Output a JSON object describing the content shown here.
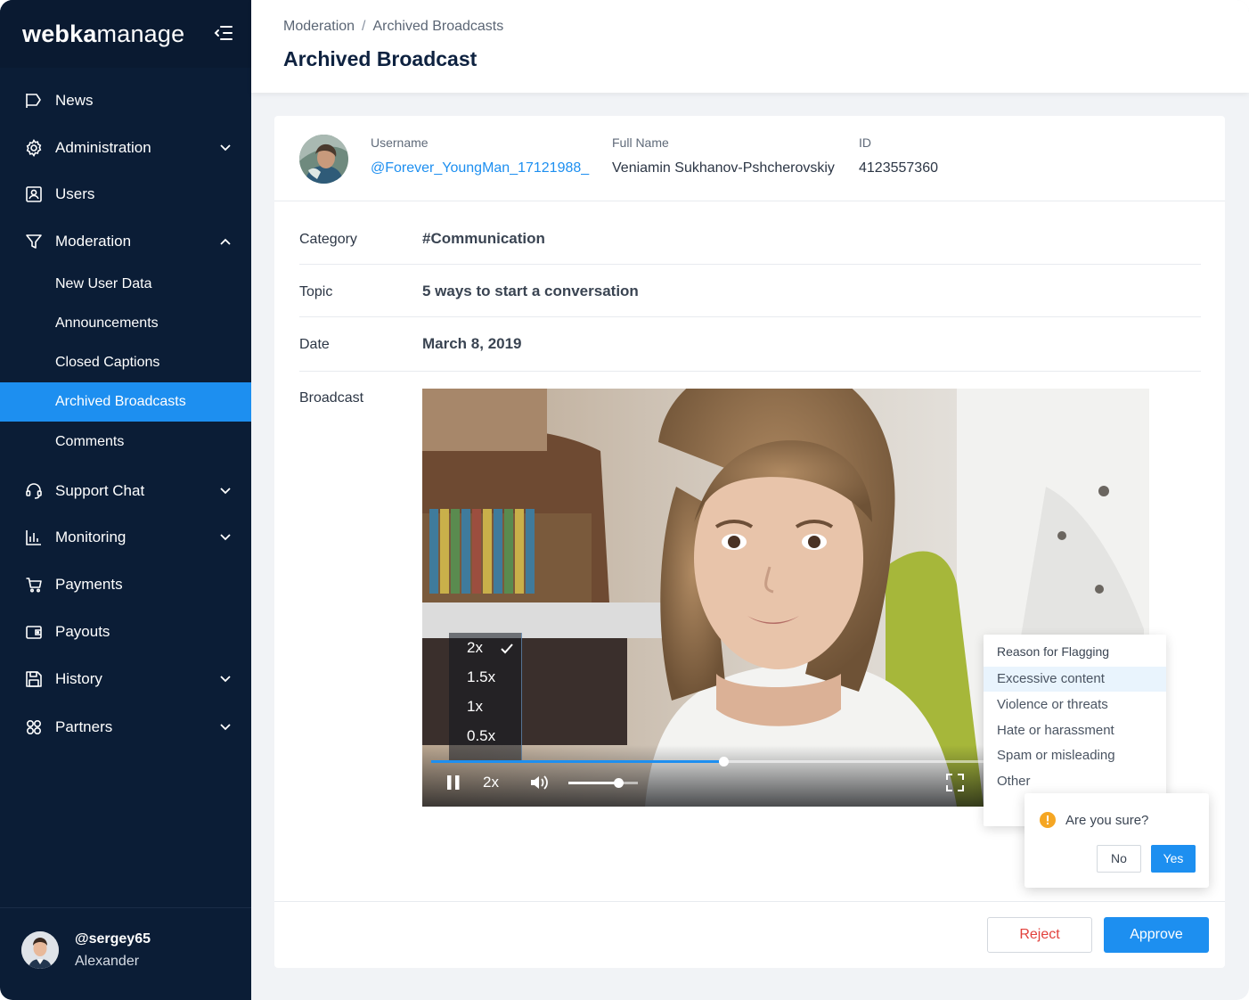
{
  "app": {
    "logo_bold": "webka",
    "logo_light": "manage",
    "accent_color": "#1d8ff0",
    "sidebar_color": "#0b1d36"
  },
  "sidebar": {
    "items": [
      {
        "label": "News",
        "icon": "flag-icon"
      },
      {
        "label": "Administration",
        "icon": "gear-icon",
        "expandable": true
      },
      {
        "label": "Users",
        "icon": "user-card-icon"
      },
      {
        "label": "Moderation",
        "icon": "filter-icon",
        "expanded": true
      },
      {
        "label": "Support Chat",
        "icon": "headset-icon",
        "expandable": true
      },
      {
        "label": "Monitoring",
        "icon": "bar-chart-icon",
        "expandable": true
      },
      {
        "label": "Payments",
        "icon": "cart-icon"
      },
      {
        "label": "Payouts",
        "icon": "wallet-icon"
      },
      {
        "label": "History",
        "icon": "save-icon",
        "expandable": true
      },
      {
        "label": "Partners",
        "icon": "partners-icon",
        "expandable": true
      }
    ],
    "moderation_sub": [
      {
        "label": "New User Data"
      },
      {
        "label": "Announcements"
      },
      {
        "label": "Closed Captions"
      },
      {
        "label": "Archived Broadcasts",
        "active": true
      },
      {
        "label": "Comments"
      }
    ],
    "user": {
      "handle": "@sergey65",
      "name": "Alexander"
    }
  },
  "header": {
    "breadcrumb": [
      "Moderation",
      "Archived Broadcasts"
    ],
    "breadcrumb_sep": "/",
    "title": "Archived Broadcast"
  },
  "profile": {
    "username_caption": "Username",
    "username": "@Forever_YoungMan_17121988_",
    "fullname_caption": "Full Name",
    "fullname": "Veniamin Sukhanov-Pshcherovskiy",
    "id_caption": "ID",
    "id": "4123557360"
  },
  "details": {
    "category_label": "Category",
    "category": "#Communication",
    "topic_label": "Topic",
    "topic": "5 ways to start a conversation",
    "date_label": "Date",
    "date": "March 8, 2019",
    "broadcast_label": "Broadcast"
  },
  "player": {
    "speed_options": [
      "2x",
      "1.5x",
      "1x",
      "0.5x"
    ],
    "selected_speed": "2x",
    "speed_label": "2x",
    "progress": 0.415,
    "volume": 0.72,
    "state": "playing"
  },
  "flag_menu": {
    "title": "Reason for Flagging",
    "options": [
      "Excessive content",
      "Violence or threats",
      "Hate or harassment",
      "Spam or misleading",
      "Other"
    ],
    "highlighted": "Excessive content"
  },
  "confirm": {
    "question": "Are you sure?",
    "no_label": "No",
    "yes_label": "Yes"
  },
  "actions": {
    "reject_label": "Reject",
    "approve_label": "Approve"
  }
}
